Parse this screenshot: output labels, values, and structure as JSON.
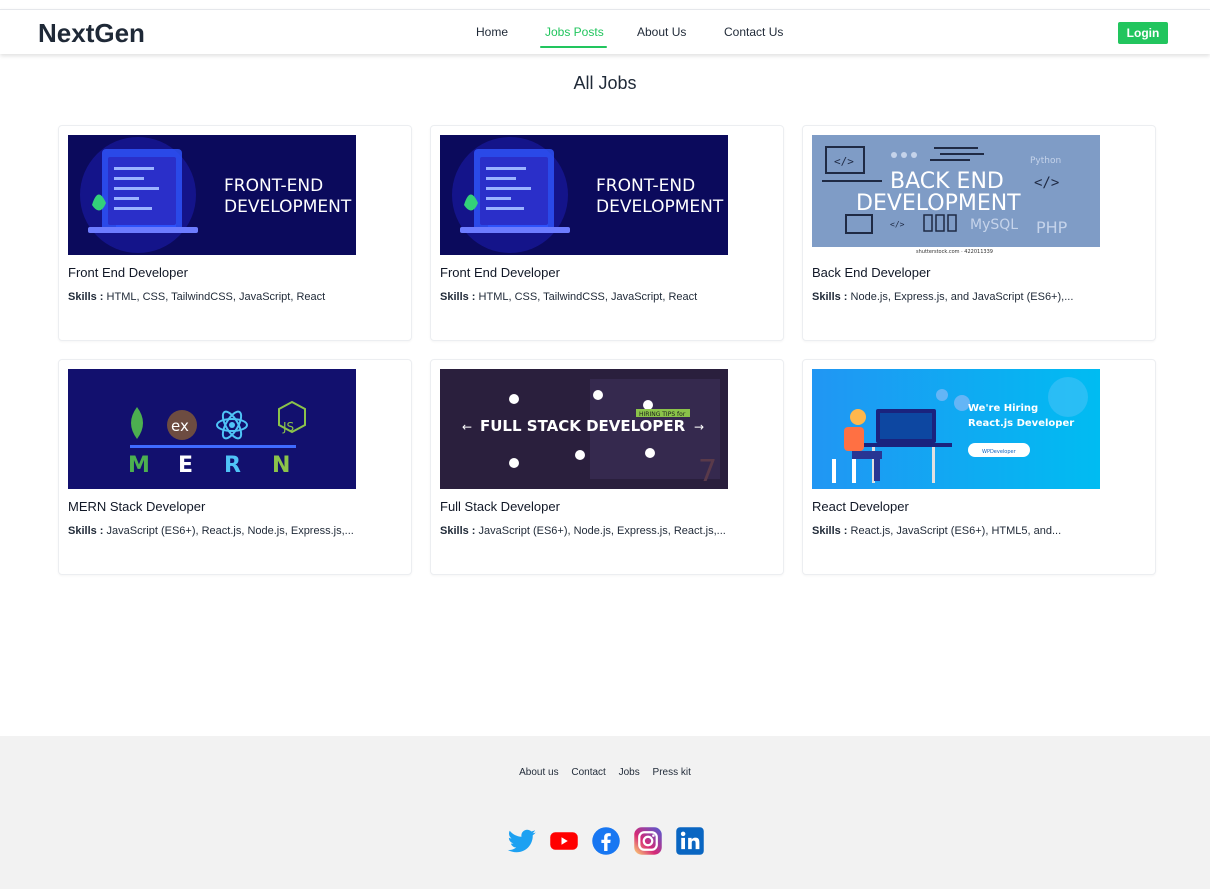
{
  "header": {
    "brand": "NextGen",
    "nav": [
      "Home",
      "Jobs Posts",
      "About Us",
      "Contact Us"
    ],
    "active_nav": "Jobs Posts",
    "login_label": "Login"
  },
  "main": {
    "title": "All Jobs",
    "skills_prefix": "Skills :",
    "jobs": [
      {
        "title": "Front End Developer",
        "skills": "HTML, CSS, TailwindCSS, JavaScript, React",
        "banner": [
          "FRONT-END",
          "DEVELOPMENT"
        ]
      },
      {
        "title": "Front End Developer",
        "skills": "HTML, CSS, TailwindCSS, JavaScript, React",
        "banner": [
          "FRONT-END",
          "DEVELOPMENT"
        ]
      },
      {
        "title": "Back End Developer",
        "skills": "Node.js, Express.js, and JavaScript (ES6+),...",
        "banner": [
          "BACK END",
          "DEVELOPMENT",
          "Python",
          "MySQL",
          "PHP",
          "shutterstock.com · 422011339"
        ]
      },
      {
        "title": "MERN Stack Developer",
        "skills": "JavaScript (ES6+), React.js, Node.js, Express.js,...",
        "banner": [
          "ex",
          "JS",
          "M",
          "E",
          "R",
          "N"
        ]
      },
      {
        "title": "Full Stack Developer",
        "skills": "JavaScript (ES6+), Node.js, Express.js, React.js,...",
        "banner": [
          "HIRING TIPS for",
          "FULL STACK DEVELOPER"
        ]
      },
      {
        "title": "React Developer",
        "skills": "React.js, JavaScript (ES6+), HTML5, and...",
        "banner": [
          "We're Hiring",
          "React.js Developer",
          "WPDeveloper"
        ]
      }
    ]
  },
  "footer": {
    "links": [
      "About us",
      "Contact",
      "Jobs",
      "Press kit"
    ],
    "social": [
      "twitter-icon",
      "youtube-icon",
      "facebook-icon",
      "instagram-icon",
      "linkedin-icon"
    ]
  },
  "colors": {
    "accent": "#22c55e",
    "footer_bg": "#f2f2f2"
  }
}
